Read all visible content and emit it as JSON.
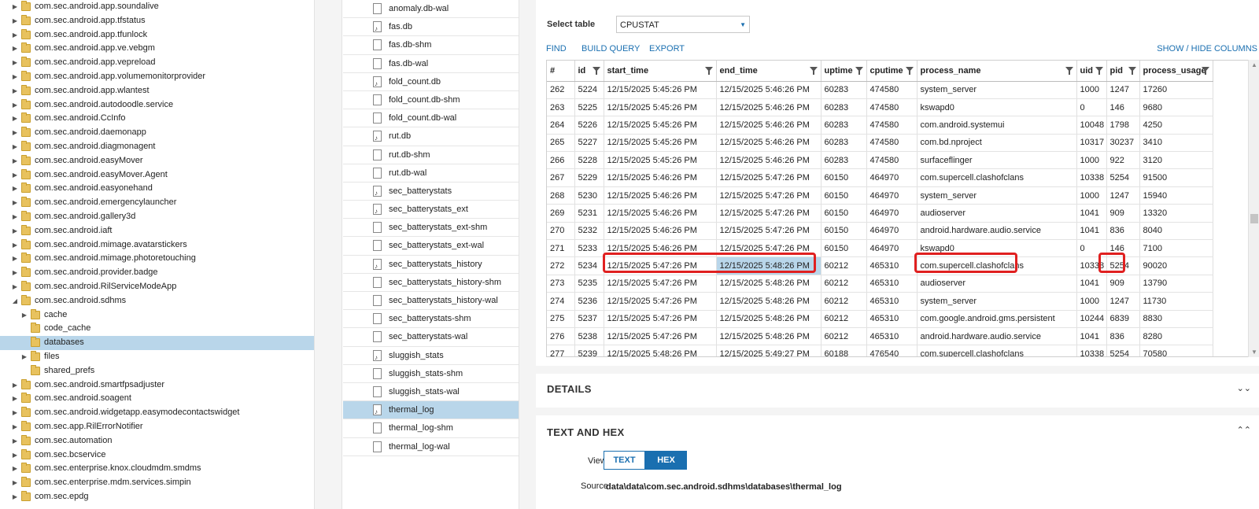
{
  "tree": {
    "items": [
      {
        "label": "com.sec.android.app.soundalive",
        "indent": 0,
        "arrow": "right"
      },
      {
        "label": "com.sec.android.app.tfstatus",
        "indent": 0,
        "arrow": "right"
      },
      {
        "label": "com.sec.android.app.tfunlock",
        "indent": 0,
        "arrow": "right"
      },
      {
        "label": "com.sec.android.app.ve.vebgm",
        "indent": 0,
        "arrow": "right"
      },
      {
        "label": "com.sec.android.app.vepreload",
        "indent": 0,
        "arrow": "right"
      },
      {
        "label": "com.sec.android.app.volumemonitorprovider",
        "indent": 0,
        "arrow": "right"
      },
      {
        "label": "com.sec.android.app.wlantest",
        "indent": 0,
        "arrow": "right"
      },
      {
        "label": "com.sec.android.autodoodle.service",
        "indent": 0,
        "arrow": "right"
      },
      {
        "label": "com.sec.android.CcInfo",
        "indent": 0,
        "arrow": "right"
      },
      {
        "label": "com.sec.android.daemonapp",
        "indent": 0,
        "arrow": "right"
      },
      {
        "label": "com.sec.android.diagmonagent",
        "indent": 0,
        "arrow": "right"
      },
      {
        "label": "com.sec.android.easyMover",
        "indent": 0,
        "arrow": "right"
      },
      {
        "label": "com.sec.android.easyMover.Agent",
        "indent": 0,
        "arrow": "right"
      },
      {
        "label": "com.sec.android.easyonehand",
        "indent": 0,
        "arrow": "right"
      },
      {
        "label": "com.sec.android.emergencylauncher",
        "indent": 0,
        "arrow": "right"
      },
      {
        "label": "com.sec.android.gallery3d",
        "indent": 0,
        "arrow": "right"
      },
      {
        "label": "com.sec.android.iaft",
        "indent": 0,
        "arrow": "right"
      },
      {
        "label": "com.sec.android.mimage.avatarstickers",
        "indent": 0,
        "arrow": "right"
      },
      {
        "label": "com.sec.android.mimage.photoretouching",
        "indent": 0,
        "arrow": "right"
      },
      {
        "label": "com.sec.android.provider.badge",
        "indent": 0,
        "arrow": "right"
      },
      {
        "label": "com.sec.android.RilServiceModeApp",
        "indent": 0,
        "arrow": "right"
      },
      {
        "label": "com.sec.android.sdhms",
        "indent": 0,
        "arrow": "down"
      },
      {
        "label": "cache",
        "indent": 1,
        "arrow": "right"
      },
      {
        "label": "code_cache",
        "indent": 1,
        "arrow": "none"
      },
      {
        "label": "databases",
        "indent": 1,
        "arrow": "none",
        "selected": true
      },
      {
        "label": "files",
        "indent": 1,
        "arrow": "right"
      },
      {
        "label": "shared_prefs",
        "indent": 1,
        "arrow": "none"
      },
      {
        "label": "com.sec.android.smartfpsadjuster",
        "indent": 0,
        "arrow": "right"
      },
      {
        "label": "com.sec.android.soagent",
        "indent": 0,
        "arrow": "right"
      },
      {
        "label": "com.sec.android.widgetapp.easymodecontactswidget",
        "indent": 0,
        "arrow": "right"
      },
      {
        "label": "com.sec.app.RilErrorNotifier",
        "indent": 0,
        "arrow": "right"
      },
      {
        "label": "com.sec.automation",
        "indent": 0,
        "arrow": "right"
      },
      {
        "label": "com.sec.bcservice",
        "indent": 0,
        "arrow": "right"
      },
      {
        "label": "com.sec.enterprise.knox.cloudmdm.smdms",
        "indent": 0,
        "arrow": "right"
      },
      {
        "label": "com.sec.enterprise.mdm.services.simpin",
        "indent": 0,
        "arrow": "right"
      },
      {
        "label": "com.sec.epdg",
        "indent": 0,
        "arrow": "right"
      }
    ]
  },
  "files": {
    "items": [
      {
        "label": "anomaly.db-wal",
        "type": "file"
      },
      {
        "label": "fas.db",
        "type": "db"
      },
      {
        "label": "fas.db-shm",
        "type": "file"
      },
      {
        "label": "fas.db-wal",
        "type": "file"
      },
      {
        "label": "fold_count.db",
        "type": "db"
      },
      {
        "label": "fold_count.db-shm",
        "type": "file"
      },
      {
        "label": "fold_count.db-wal",
        "type": "file"
      },
      {
        "label": "rut.db",
        "type": "db"
      },
      {
        "label": "rut.db-shm",
        "type": "file"
      },
      {
        "label": "rut.db-wal",
        "type": "file"
      },
      {
        "label": "sec_batterystats",
        "type": "db"
      },
      {
        "label": "sec_batterystats_ext",
        "type": "db"
      },
      {
        "label": "sec_batterystats_ext-shm",
        "type": "file"
      },
      {
        "label": "sec_batterystats_ext-wal",
        "type": "file"
      },
      {
        "label": "sec_batterystats_history",
        "type": "db"
      },
      {
        "label": "sec_batterystats_history-shm",
        "type": "file"
      },
      {
        "label": "sec_batterystats_history-wal",
        "type": "file"
      },
      {
        "label": "sec_batterystats-shm",
        "type": "file"
      },
      {
        "label": "sec_batterystats-wal",
        "type": "file"
      },
      {
        "label": "sluggish_stats",
        "type": "db"
      },
      {
        "label": "sluggish_stats-shm",
        "type": "file"
      },
      {
        "label": "sluggish_stats-wal",
        "type": "file"
      },
      {
        "label": "thermal_log",
        "type": "db",
        "selected": true
      },
      {
        "label": "thermal_log-shm",
        "type": "file"
      },
      {
        "label": "thermal_log-wal",
        "type": "file"
      }
    ]
  },
  "table_panel": {
    "select_label": "Select table",
    "selected_table": "CPUSTAT",
    "find": "FIND",
    "build_query": "BUILD QUERY",
    "export": "EXPORT",
    "show_hide": "SHOW / HIDE COLUMNS",
    "columns": [
      "#",
      "id",
      "start_time",
      "end_time",
      "uptime",
      "cputime",
      "process_name",
      "uid",
      "pid",
      "process_usage"
    ],
    "rows": [
      [
        "262",
        "5224",
        "12/15/2025 5:45:26 PM",
        "12/15/2025 5:46:26 PM",
        "60283",
        "474580",
        "system_server",
        "1000",
        "1247",
        "17260"
      ],
      [
        "263",
        "5225",
        "12/15/2025 5:45:26 PM",
        "12/15/2025 5:46:26 PM",
        "60283",
        "474580",
        "kswapd0",
        "0",
        "146",
        "9680"
      ],
      [
        "264",
        "5226",
        "12/15/2025 5:45:26 PM",
        "12/15/2025 5:46:26 PM",
        "60283",
        "474580",
        "com.android.systemui",
        "10048",
        "1798",
        "4250"
      ],
      [
        "265",
        "5227",
        "12/15/2025 5:45:26 PM",
        "12/15/2025 5:46:26 PM",
        "60283",
        "474580",
        "com.bd.nproject",
        "10317",
        "30237",
        "3410"
      ],
      [
        "266",
        "5228",
        "12/15/2025 5:45:26 PM",
        "12/15/2025 5:46:26 PM",
        "60283",
        "474580",
        "surfaceflinger",
        "1000",
        "922",
        "3120"
      ],
      [
        "267",
        "5229",
        "12/15/2025 5:46:26 PM",
        "12/15/2025 5:47:26 PM",
        "60150",
        "464970",
        "com.supercell.clashofclans",
        "10338",
        "5254",
        "91500"
      ],
      [
        "268",
        "5230",
        "12/15/2025 5:46:26 PM",
        "12/15/2025 5:47:26 PM",
        "60150",
        "464970",
        "system_server",
        "1000",
        "1247",
        "15940"
      ],
      [
        "269",
        "5231",
        "12/15/2025 5:46:26 PM",
        "12/15/2025 5:47:26 PM",
        "60150",
        "464970",
        "audioserver",
        "1041",
        "909",
        "13320"
      ],
      [
        "270",
        "5232",
        "12/15/2025 5:46:26 PM",
        "12/15/2025 5:47:26 PM",
        "60150",
        "464970",
        "android.hardware.audio.service",
        "1041",
        "836",
        "8040"
      ],
      [
        "271",
        "5233",
        "12/15/2025 5:46:26 PM",
        "12/15/2025 5:47:26 PM",
        "60150",
        "464970",
        "kswapd0",
        "0",
        "146",
        "7100"
      ],
      [
        "272",
        "5234",
        "12/15/2025 5:47:26 PM",
        "12/15/2025 5:48:26 PM",
        "60212",
        "465310",
        "com.supercell.clashofclans",
        "10338",
        "5254",
        "90020"
      ],
      [
        "273",
        "5235",
        "12/15/2025 5:47:26 PM",
        "12/15/2025 5:48:26 PM",
        "60212",
        "465310",
        "audioserver",
        "1041",
        "909",
        "13790"
      ],
      [
        "274",
        "5236",
        "12/15/2025 5:47:26 PM",
        "12/15/2025 5:48:26 PM",
        "60212",
        "465310",
        "system_server",
        "1000",
        "1247",
        "11730"
      ],
      [
        "275",
        "5237",
        "12/15/2025 5:47:26 PM",
        "12/15/2025 5:48:26 PM",
        "60212",
        "465310",
        "com.google.android.gms.persistent",
        "10244",
        "6839",
        "8830"
      ],
      [
        "276",
        "5238",
        "12/15/2025 5:47:26 PM",
        "12/15/2025 5:48:26 PM",
        "60212",
        "465310",
        "android.hardware.audio.service",
        "1041",
        "836",
        "8280"
      ],
      [
        "277",
        "5239",
        "12/15/2025 5:48:26 PM",
        "12/15/2025 5:49:27 PM",
        "60188",
        "476540",
        "com.supercell.clashofclans",
        "10338",
        "5254",
        "70580"
      ]
    ]
  },
  "details_panel": {
    "title": "DETAILS"
  },
  "hex_panel": {
    "title": "TEXT AND HEX",
    "view_label": "View",
    "text_btn": "TEXT",
    "hex_btn": "HEX",
    "source_label": "Source",
    "source_value": "data\\data\\com.sec.android.sdhms\\databases\\thermal_log"
  },
  "colors": {
    "accent": "#1a6fb0",
    "selection": "#b9d6ea",
    "highlight_box": "#e02020",
    "folder": "#e8c25e"
  }
}
